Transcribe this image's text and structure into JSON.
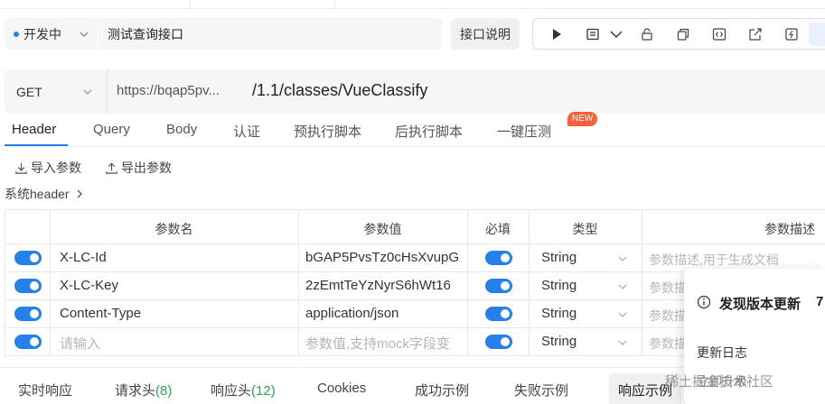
{
  "request": {
    "status": "开发中",
    "name": "测试查询接口",
    "doc_button": "接口说明",
    "method": "GET",
    "base_url": "https://bqap5pv...",
    "path": "/1.1/classes/VueClassify"
  },
  "toolbar": {
    "icons": [
      "play-icon",
      "save-icon",
      "chevron-down-icon",
      "lock-icon",
      "copy-icon",
      "code-icon",
      "share-icon",
      "export-icon",
      "more-icon"
    ]
  },
  "tabs": [
    {
      "label": "Header",
      "active": true
    },
    {
      "label": "Query"
    },
    {
      "label": "Body"
    },
    {
      "label": "认证"
    },
    {
      "label": "预执行脚本"
    },
    {
      "label": "后执行脚本"
    },
    {
      "label": "一键压测"
    }
  ],
  "new_badge": "NEW",
  "actions": {
    "import": "导入参数",
    "export": "导出参数",
    "system_header": "系统header"
  },
  "table": {
    "headers": [
      "参数名",
      "参数值",
      "必填",
      "类型",
      "参数描述"
    ],
    "rows": [
      {
        "name": "X-LC-Id",
        "value": "bGAP5PvsTz0cHsXvupG",
        "type": "String",
        "desc": "参数描述,用于生成文档"
      },
      {
        "name": "X-LC-Key",
        "value": "2zEmtTeYzNyrS6hWt16",
        "type": "String",
        "desc": "参数描"
      },
      {
        "name": "Content-Type",
        "value": "application/json",
        "type": "String",
        "desc": "参数描"
      },
      {
        "name": "请输入",
        "value": "参数值,支持mock字段变",
        "type": "String",
        "desc": "参数描",
        "placeholder": true
      }
    ]
  },
  "popup": {
    "title": "发现版本更新",
    "number": "7",
    "changelog": "更新日志",
    "more": "立即升级"
  },
  "watermark": "稀土掘金技术社区",
  "bottom_tabs": {
    "realtime": "实时响应",
    "req_headers": "请求头",
    "req_headers_count": "(8)",
    "resp_headers": "响应头",
    "resp_headers_count": "(12)",
    "cookies": "Cookies",
    "success": "成功示例",
    "fail": "失败示例",
    "resp_example": "响应示例"
  },
  "colors": {
    "accent": "#2680eb",
    "badge": "#f5603c",
    "count": "#2ca64b"
  }
}
